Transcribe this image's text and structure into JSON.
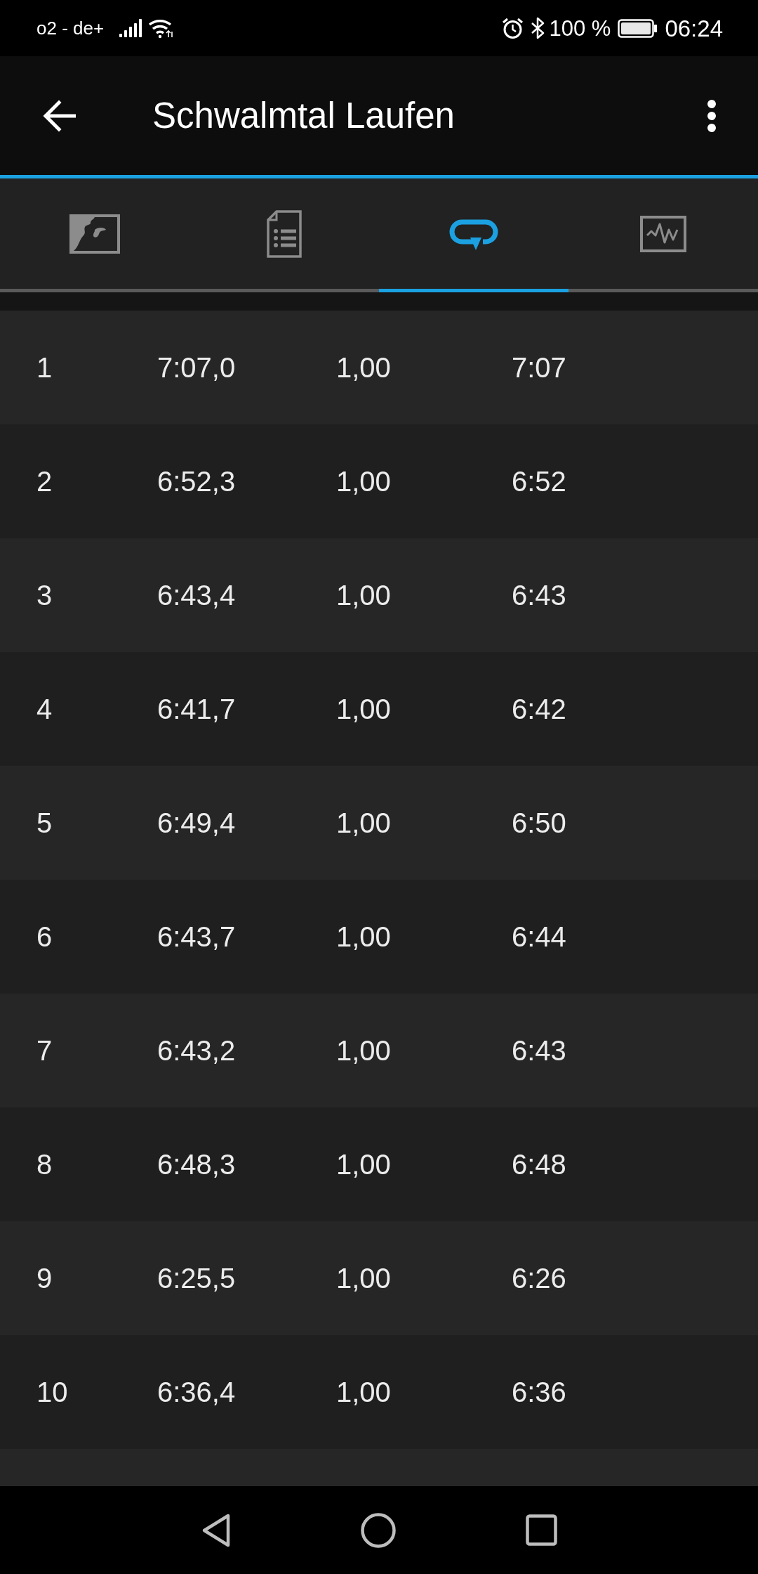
{
  "status_bar": {
    "carrier": "o2 - de+",
    "battery": "100 %",
    "time": "06:24"
  },
  "app_bar": {
    "title": "Schwalmtal Laufen"
  },
  "tabs": [
    {
      "kind": "map",
      "selected": false
    },
    {
      "kind": "details",
      "selected": false
    },
    {
      "kind": "laps",
      "selected": true
    },
    {
      "kind": "chart",
      "selected": false
    }
  ],
  "laps": {
    "rows": [
      [
        "1",
        "7:07,0",
        "1,00",
        "7:07"
      ],
      [
        "2",
        "6:52,3",
        "1,00",
        "6:52"
      ],
      [
        "3",
        "6:43,4",
        "1,00",
        "6:43"
      ],
      [
        "4",
        "6:41,7",
        "1,00",
        "6:42"
      ],
      [
        "5",
        "6:49,4",
        "1,00",
        "6:50"
      ],
      [
        "6",
        "6:43,7",
        "1,00",
        "6:44"
      ],
      [
        "7",
        "6:43,2",
        "1,00",
        "6:43"
      ],
      [
        "8",
        "6:48,3",
        "1,00",
        "6:48"
      ],
      [
        "9",
        "6:25,5",
        "1,00",
        "6:26"
      ],
      [
        "10",
        "6:36,4",
        "1,00",
        "6:36"
      ]
    ]
  }
}
